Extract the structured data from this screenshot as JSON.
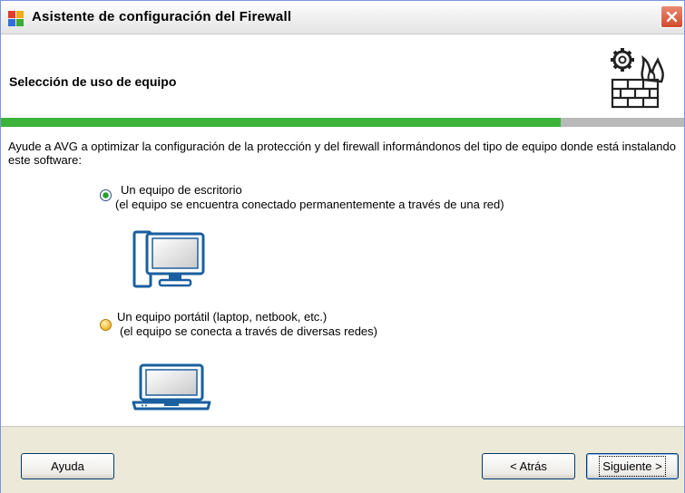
{
  "window": {
    "title": "Asistente de configuración del Firewall",
    "close_glyph": "✕"
  },
  "header": {
    "title": "Selección de uso de equipo",
    "icon": "firewall-gear-icon"
  },
  "progress": {
    "fraction": 0.82,
    "color": "#3cb43c"
  },
  "content": {
    "intro": "Ayude a AVG a optimizar la configuración de la protección y del firewall informándonos del tipo de equipo donde está instalando este software:",
    "options": [
      {
        "label": "Un equipo de escritorio",
        "description": "(el equipo se encuentra conectado permanentemente a través de una red)",
        "selected": true,
        "icon": "desktop-computer-icon"
      },
      {
        "label": "Un equipo portátil (laptop, netbook, etc.)",
        "description": "(el equipo se conecta a través de diversas redes)",
        "selected": false,
        "icon": "laptop-icon"
      }
    ]
  },
  "footer": {
    "help_label": "Ayuda",
    "back_label": "< Atrás",
    "next_label": "Siguiente >"
  }
}
